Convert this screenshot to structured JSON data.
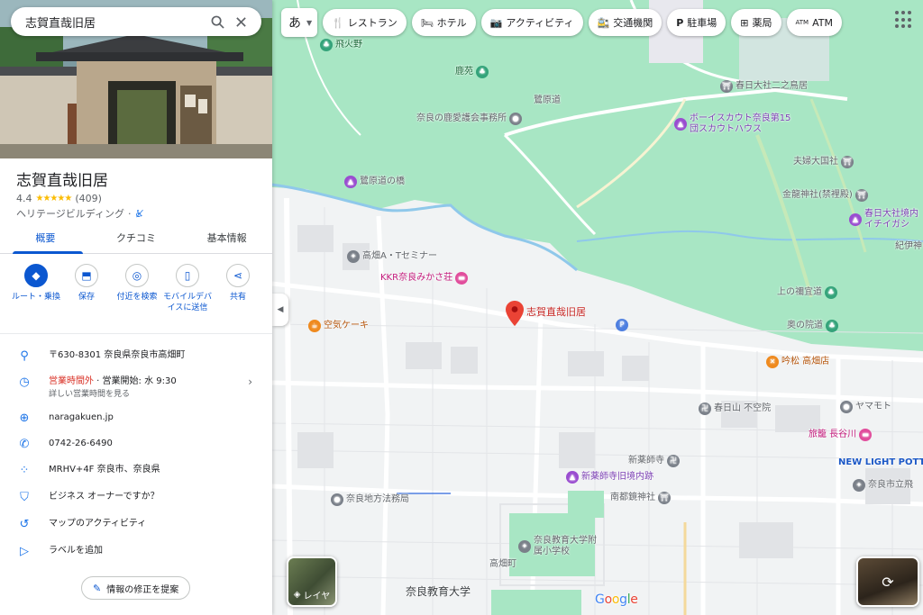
{
  "search": {
    "query": "志賀直哉旧居"
  },
  "place": {
    "name": "志賀直哉旧居",
    "rating": "4.4",
    "stars": "★★★★★",
    "review_count": "(409)",
    "category": "ヘリテージビルディング",
    "separator": "·",
    "accessibility_icon": "accessibility-icon"
  },
  "tabs": [
    {
      "label": "概要"
    },
    {
      "label": "クチコミ"
    },
    {
      "label": "基本情報"
    }
  ],
  "actions": [
    {
      "label": "ルート・乗換",
      "icon": "directions-icon"
    },
    {
      "label": "保存",
      "icon": "bookmark-icon"
    },
    {
      "label": "付近を検索",
      "icon": "nearby-icon"
    },
    {
      "label": "モバイルデバイスに送信",
      "icon": "send-to-phone-icon"
    },
    {
      "label": "共有",
      "icon": "share-icon"
    }
  ],
  "info": {
    "address": "〒630-8301 奈良県奈良市高畑町",
    "hours_status": "営業時間外",
    "hours_next": " · 営業開始: 水 9:30",
    "hours_more": "詳しい営業時間を見る",
    "website": "naragakuen.jp",
    "phone": "0742-26-6490",
    "plus_code": "MRHV+4F 奈良市、奈良県",
    "claim": "ビジネス オーナーですか？",
    "activity": "マップのアクティビティ",
    "label": "ラベルを追加"
  },
  "suggest_edit": "情報の修正を提案",
  "map": {
    "lang_button": "あ",
    "chips": [
      {
        "label": "レストラン",
        "icon": "restaurant-icon"
      },
      {
        "label": "ホテル",
        "icon": "hotel-icon"
      },
      {
        "label": "アクティビティ",
        "icon": "camera-icon"
      },
      {
        "label": "交通機関",
        "icon": "transit-icon"
      },
      {
        "label": "駐車場",
        "icon": "parking-icon"
      },
      {
        "label": "薬局",
        "icon": "pharmacy-icon"
      },
      {
        "label": "ATM",
        "icon": "atm-icon"
      }
    ],
    "layer_label": "レイヤ",
    "google": "Google",
    "labels": {
      "tobihino": "飛火野",
      "rokuen": "鹿苑",
      "sagiharamichi": "鷺原道",
      "aigokai": "奈良の鹿愛護会事務所",
      "kasuga_ninotorii": "春日大社二之鳥居",
      "boyscout": "ボーイスカウト奈良第15団スカウトハウス",
      "meoto": "夫婦大国社",
      "kinryu": "金龍神社(禁裡殿)",
      "kasuga_inner": "春日大社境内イチイガシ",
      "kiiishi": "紀伊神",
      "sagi_hashi": "鷺原道の橋",
      "takabatake_seminar": "高畑A・Tセミナー",
      "kkr": "KKR奈良みかさ荘",
      "kuuki": "空気ケーキ",
      "target": "志賀直哉旧居",
      "kamino": "上の禰宜道",
      "okuno": "奥の院道",
      "ginmatsu": "吟松 高畑店",
      "kasugayama": "春日山 不空院",
      "yamamoto": "ヤマモト",
      "ryokan_hase": "旅籠 長谷川",
      "shinyakushiji": "新薬師寺",
      "shinyaku_ato": "新薬師寺旧境内跡",
      "new_light": "NEW LIGHT POTTER",
      "nanto": "南都鏡神社",
      "narashi_school": "奈良市立飛",
      "chiho": "奈良地方法務局",
      "fuzoku": "奈良教育大学附属小学校",
      "takabatake_cho": "高畑町",
      "kyoiku_univ": "奈良教育大学",
      "park_p": "P"
    }
  }
}
